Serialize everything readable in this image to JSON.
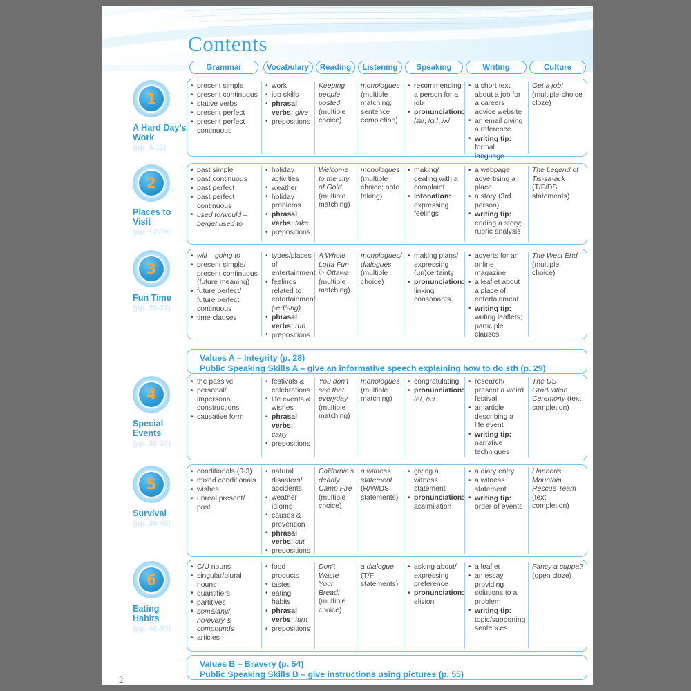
{
  "page": {
    "title": "Contents",
    "page_number": "2"
  },
  "columns": [
    {
      "label": "Grammar"
    },
    {
      "label": "Vocabulary"
    },
    {
      "label": "Reading"
    },
    {
      "label": "Listening"
    },
    {
      "label": "Speaking"
    },
    {
      "label": "Writing"
    },
    {
      "label": "Culture"
    }
  ],
  "units": [
    {
      "number": "1",
      "title": "A Hard Day’s Work",
      "pages": "(pp. 4-11)",
      "grammar": [
        "present simple",
        "present continuous",
        "stative verbs",
        "present perfect",
        "present perfect continuous"
      ],
      "vocabulary": [
        "work",
        "job skills",
        "phrasal verbs: give",
        "prepositions"
      ],
      "reading": "Keeping people posted (multiple choice)",
      "listening": "monologues (multiple matching; sentence completion)",
      "speaking": [
        "recommending a person for a job",
        "pronunciation: /æ/, /ɑː/, /ʌ/"
      ],
      "writing": [
        "a short text about a job for a careers advice website",
        "an email giving a reference",
        "writing tip: formal language"
      ],
      "culture": "Get a job! (multiple-choice cloze)"
    },
    {
      "number": "2",
      "title": "Places to Visit",
      "pages": "(pp. 12-19)",
      "grammar": [
        "past simple",
        "past continuous",
        "past perfect",
        "past perfect continuous",
        "used to/would – be/get used to"
      ],
      "vocabulary": [
        "holiday activities",
        "weather",
        "holiday problems",
        "phrasal verbs: take",
        "prepositions"
      ],
      "reading": "Welcome to the city of Gold (multiple matching)",
      "listening": "monologues (multiple choice; note taking)",
      "speaking": [
        "making/ dealing with a complaint",
        "intonation: expressing feelings"
      ],
      "writing": [
        "a webpage advertising a place",
        "a story (3rd person)",
        "writing tip: ending a story; rubric analysis"
      ],
      "culture": "The Legend of Tis-sa-ack (T/F/DS statements)"
    },
    {
      "number": "3",
      "title": "Fun Time",
      "pages": "(pp. 20-27)",
      "grammar": [
        "will – going to",
        "present simple/ present continuous (future meaning)",
        "future perfect/ future perfect continuous",
        "time clauses"
      ],
      "vocabulary": [
        "types/places of entertainment",
        "feelings related to entertainment (-ed/-ing)",
        "phrasal verbs: run",
        "prepositions"
      ],
      "reading": "A Whole Lotta Fun in Ottawa (multiple matching)",
      "listening": "monologues/ dialogues (multiple choice)",
      "speaking": [
        "making plans/ expressing (un)certainty",
        "pronunciation: linking consonants"
      ],
      "writing": [
        "adverts for an online magazine",
        "a leaflet about a place of entertainment",
        "writing tip: writing leaflets; participle clauses"
      ],
      "culture": "The West End (multiple choice)"
    },
    {
      "number": "4",
      "title": "Special Events",
      "pages": "(pp. 30-37)",
      "grammar": [
        "the passive",
        "personal/ impersonal constructions",
        "causative form"
      ],
      "vocabulary": [
        "festivals & celebrations",
        "life events & wishes",
        "phrasal verbs: carry",
        "prepositions"
      ],
      "reading": "You don’t see that everyday (multiple matching)",
      "listening": "monologues (multiple matching)",
      "speaking": [
        "congratulating",
        "pronunciation: /e/, /ɜː/"
      ],
      "writing": [
        "research/ present a weird festival",
        "an article describing a life event",
        "writing tip: narrative techniques"
      ],
      "culture": "The US Graduation Ceremony (text completion)"
    },
    {
      "number": "5",
      "title": "Survival",
      "pages": "(pp. 38-45)",
      "grammar": [
        "conditionals (0-3)",
        "mixed conditionals",
        "wishes",
        "unreal present/ past"
      ],
      "vocabulary": [
        "natural disasters/ accidents",
        "weather idioms",
        "causes & prevention",
        "phrasal verbs: cut",
        "prepositions"
      ],
      "reading": "California’s deadly Camp Fire (multiple choice)",
      "listening": "a witness statement (R/W/DS statements)",
      "speaking": [
        "giving a witness statement",
        "pronunciation: assimilation"
      ],
      "writing": [
        "a diary entry",
        "a witness statement",
        "writing tip: order of events"
      ],
      "culture": "Llanberis Mountain Rescue Team (text completion)"
    },
    {
      "number": "6",
      "title": "Eating Habits",
      "pages": "(pp. 46-53)",
      "grammar": [
        "C/U nouns",
        "singular/plural nouns",
        "quantifiers",
        "partitives",
        "some/any/ no/every & compounds",
        "articles"
      ],
      "vocabulary": [
        "food products",
        "tastes",
        "eating habits",
        "phrasal verbs: turn",
        "prepositions"
      ],
      "reading": "Don’t Waste Your Bread! (multiple choice)",
      "listening": "a dialogue (T/F statements)",
      "speaking": [
        "asking about/ expressing preference",
        "pronunciation: elision"
      ],
      "writing": [
        "a leaflet",
        "an essay providing solutions to a problem",
        "writing tip: topic/supporting sentences"
      ],
      "culture": "Fancy a cuppa? (open cloze)"
    }
  ],
  "banners": [
    {
      "line1": "Values A – Integrity (p. 28)",
      "line2": "Public Speaking Skills A – give an informative speech explaining how to do sth (p. 29)"
    },
    {
      "line1": "Values B – Bravery (p. 54)",
      "line2": "Public Speaking Skills B – give instructions using pictures (p. 55)"
    }
  ],
  "colors": {
    "accent": "#2e9ad6",
    "border": "#79c6ec",
    "badge_number": "#f5a83c"
  }
}
